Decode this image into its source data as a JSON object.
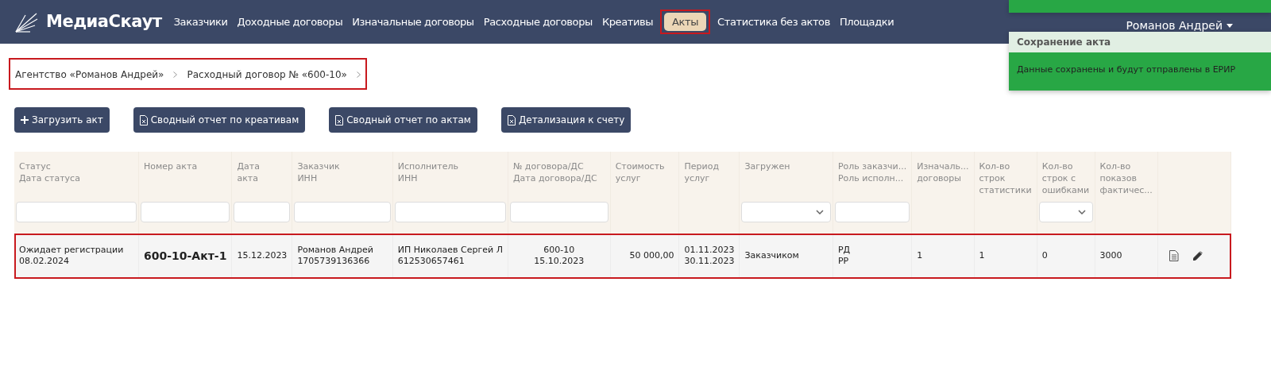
{
  "navbar": {
    "brand": "МедиаСкаут",
    "items": [
      {
        "label": "Заказчики",
        "selected": false
      },
      {
        "label": "Доходные договоры",
        "selected": false
      },
      {
        "label": "Изначальные договоры",
        "selected": false
      },
      {
        "label": "Расходные договоры",
        "selected": false
      },
      {
        "label": "Креативы",
        "selected": false
      },
      {
        "label": "Акты",
        "selected": true
      },
      {
        "label": "Статистика без актов",
        "selected": false
      },
      {
        "label": "Площадки",
        "selected": false
      }
    ],
    "user": "Романов Андрей"
  },
  "toast": {
    "title": "Сохранение акта",
    "message": "Данные сохранены и будут отправлены в ЕРИР"
  },
  "breadcrumb": [
    "Агентство «Романов Андрей»",
    "Расходный договор № «600-10»"
  ],
  "buttons": [
    {
      "label": "Загрузить акт",
      "kind": "add"
    },
    {
      "label": "Сводный отчет по креативам",
      "kind": "report"
    },
    {
      "label": "Сводный отчет по актам",
      "kind": "report"
    },
    {
      "label": "Детализация к счету",
      "kind": "report"
    }
  ],
  "table": {
    "columns": [
      {
        "lines": [
          "Статус",
          "Дата статуса"
        ],
        "kind": "text"
      },
      {
        "lines": [
          "Номер акта"
        ],
        "kind": "text"
      },
      {
        "lines": [
          "Дата",
          "акта"
        ],
        "kind": "text"
      },
      {
        "lines": [
          "Заказчик",
          "ИНН"
        ],
        "kind": "text"
      },
      {
        "lines": [
          "Исполнитель",
          "ИНН"
        ],
        "kind": "text"
      },
      {
        "lines": [
          "№ договора/ДС",
          "Дата договора/ДС"
        ],
        "kind": "text"
      },
      {
        "lines": [
          "Стоимость",
          "услуг"
        ],
        "kind": "none"
      },
      {
        "lines": [
          "Период",
          "услуг"
        ],
        "kind": "none"
      },
      {
        "lines": [
          "Загружен"
        ],
        "kind": "select"
      },
      {
        "lines": [
          "Роль заказчи...",
          "Роль исполн..."
        ],
        "kind": "text"
      },
      {
        "lines": [
          "Изначаль...",
          "договоры"
        ],
        "kind": "none"
      },
      {
        "lines": [
          "Кол-во",
          "строк",
          "статистики"
        ],
        "kind": "none"
      },
      {
        "lines": [
          "Кол-во",
          "строк с",
          "ошибками"
        ],
        "kind": "select"
      },
      {
        "lines": [
          "Кол-во",
          "показов",
          "фактичес..."
        ],
        "kind": "none"
      },
      {
        "kind": "actions"
      }
    ],
    "rows": [
      {
        "cells": [
          [
            "Ожидает регистрации",
            "08.02.2024"
          ],
          [
            "600-10-Акт-1"
          ],
          [
            "15.12.2023"
          ],
          [
            "Романов Андрей",
            "1705739136366"
          ],
          [
            "ИП Николаев Сергей Л",
            "612530657461"
          ],
          [
            "600-10",
            "15.10.2023"
          ],
          [
            "50 000,00"
          ],
          [
            "01.11.2023",
            "30.11.2023"
          ],
          [
            "Заказчиком"
          ],
          [
            "РД",
            "РР"
          ],
          [
            "1"
          ],
          [
            "1"
          ],
          [
            "0"
          ],
          [
            "3000"
          ]
        ]
      }
    ]
  }
}
